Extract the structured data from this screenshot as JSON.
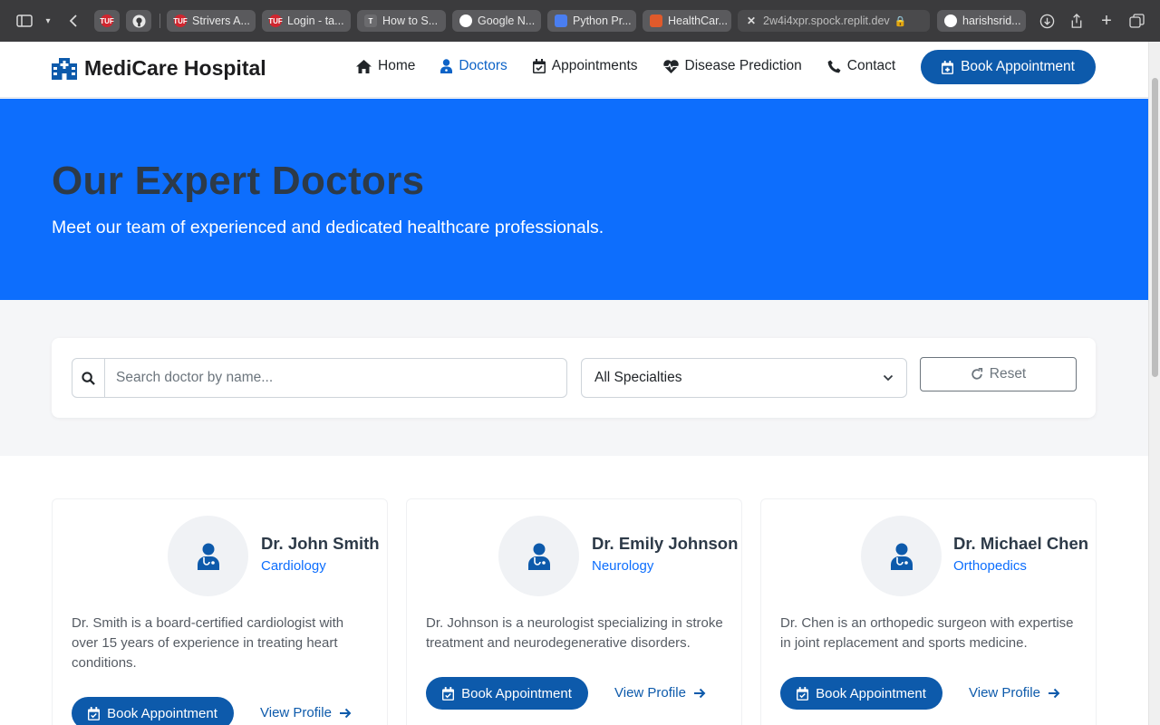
{
  "browser": {
    "tabs": [
      {
        "label": "Strivers A..."
      },
      {
        "label": "Login - ta..."
      },
      {
        "label": "How to S..."
      },
      {
        "label": "Google N..."
      },
      {
        "label": "Python Pr..."
      },
      {
        "label": "HealthCar..."
      },
      {
        "label": "2w4i4xpr.spock.replit.dev"
      },
      {
        "label": "harishsrid..."
      }
    ]
  },
  "site": {
    "brand": "MediCare Hospital",
    "nav": [
      {
        "label": "Home",
        "icon": "home-icon"
      },
      {
        "label": "Doctors",
        "icon": "doctor-icon"
      },
      {
        "label": "Appointments",
        "icon": "calendar-icon"
      },
      {
        "label": "Disease Prediction",
        "icon": "heartbeat-icon"
      },
      {
        "label": "Contact",
        "icon": "phone-icon"
      }
    ],
    "book_button": "Book Appointment",
    "accent_color": "#0d6efd",
    "button_color": "#0d5aab"
  },
  "hero": {
    "title": "Our Expert Doctors",
    "subtitle": "Meet our team of experienced and dedicated healthcare professionals."
  },
  "filters": {
    "search_placeholder": "Search doctor by name...",
    "specialty_selected": "All Specialties",
    "reset_label": "Reset"
  },
  "doctors": [
    {
      "name": "Dr. John Smith",
      "specialty": "Cardiology",
      "description": "Dr. Smith is a board-certified cardiologist with over 15 years of experience in treating heart conditions.",
      "book_label": "Book Appointment",
      "profile_label": "View Profile"
    },
    {
      "name": "Dr. Emily Johnson",
      "specialty": "Neurology",
      "description": "Dr. Johnson is a neurologist specializing in stroke treatment and neurodegenerative disorders.",
      "book_label": "Book Appointment",
      "profile_label": "View Profile"
    },
    {
      "name": "Dr. Michael Chen",
      "specialty": "Orthopedics",
      "description": "Dr. Chen is an orthopedic surgeon with expertise in joint replacement and sports medicine.",
      "book_label": "Book Appointment",
      "profile_label": "View Profile"
    }
  ]
}
